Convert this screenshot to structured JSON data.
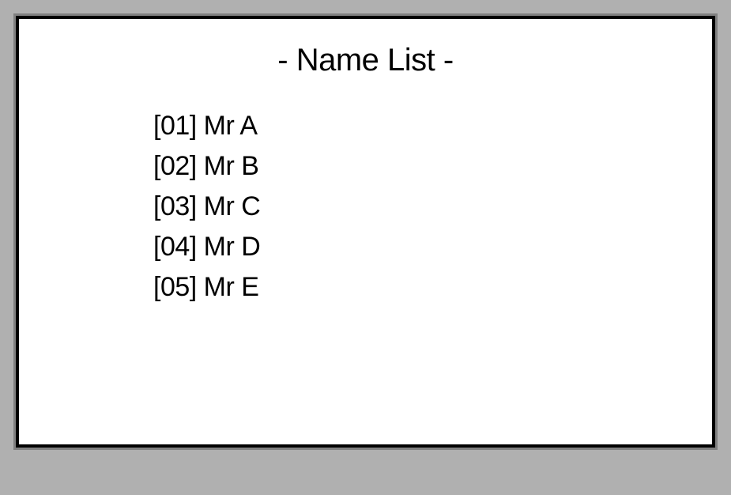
{
  "header": {
    "title": "- Name List -"
  },
  "names": {
    "items": [
      {
        "display": "[01] Mr A"
      },
      {
        "display": "[02] Mr B"
      },
      {
        "display": "[03] Mr C"
      },
      {
        "display": "[04] Mr D"
      },
      {
        "display": "[05] Mr E"
      }
    ]
  }
}
